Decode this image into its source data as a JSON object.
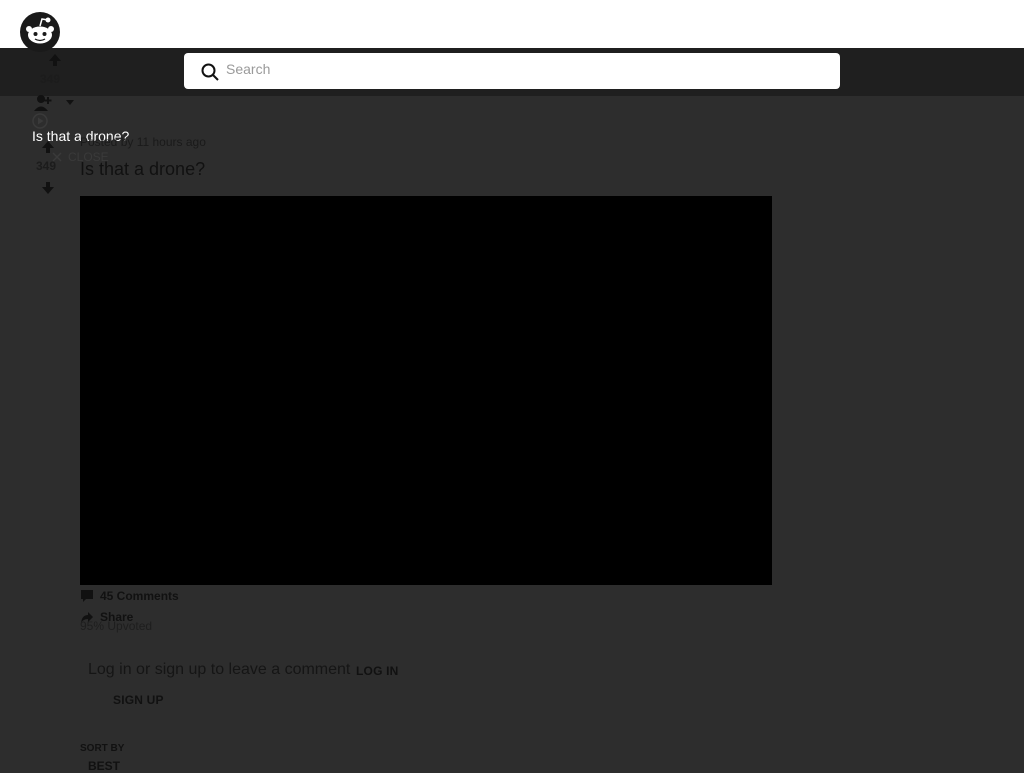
{
  "search": {
    "placeholder": "Search"
  },
  "sidebar": {
    "top_votes": "349",
    "post_votes": "349"
  },
  "tooltip": {
    "text": "Is that a drone?"
  },
  "close_label": "CLOSE",
  "post": {
    "posted_by": "Posted by",
    "time_ago": "11 hours ago",
    "title": "Is that a drone?",
    "comments_label": "45 Comments",
    "share_label": "Share",
    "upvoted_label": "95% Upvoted"
  },
  "comment_box": {
    "prompt": "Log in or sign up to leave a comment",
    "login_label": "LOG IN",
    "signup_label": "SIGN UP"
  },
  "sort": {
    "label": "SORT BY",
    "value": "BEST"
  },
  "colors": {
    "page_bg": "#2d2d2d",
    "topbar": "#ffffff",
    "darkbar": "#1f1f1f",
    "video": "#000000"
  },
  "icons": [
    "reddit-logo-icon",
    "search-icon",
    "upvote-icon",
    "downvote-icon",
    "user-add-icon",
    "chevron-down-icon",
    "play-icon",
    "close-icon",
    "comment-icon",
    "share-icon"
  ]
}
